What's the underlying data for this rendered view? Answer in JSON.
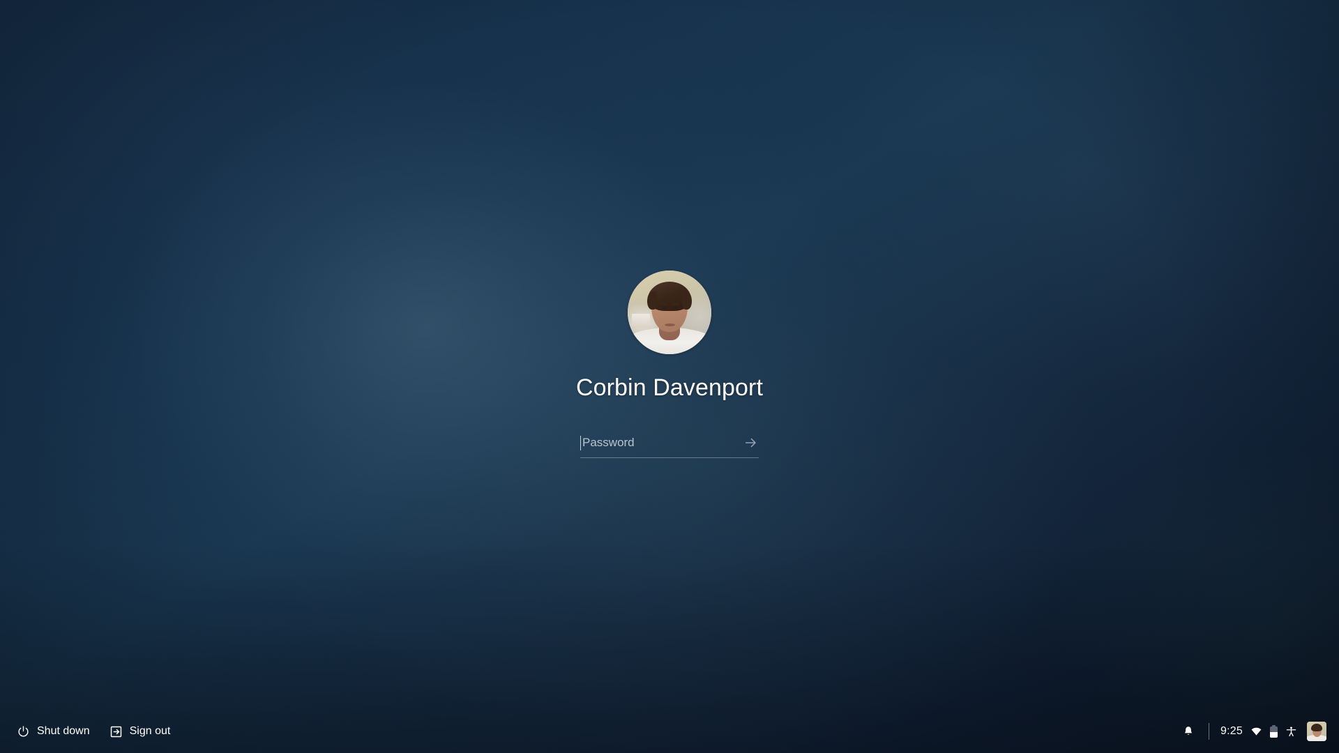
{
  "screen": {
    "kind": "lock-screen",
    "background_colors": {
      "base": "#16314b",
      "dark_edge": "#0b1624",
      "glow": "#48687e",
      "shelf": "#0d1829"
    }
  },
  "login": {
    "user_name": "Corbin Davenport",
    "avatar_icon": "user-avatar-photo",
    "password": {
      "value": "",
      "placeholder": "Password",
      "submit_icon": "arrow-right-icon",
      "caret_visible": true
    }
  },
  "shelf": {
    "left_buttons": [
      {
        "label": "Shut down",
        "icon": "power-icon"
      },
      {
        "label": "Sign out",
        "icon": "exit-to-app-icon"
      }
    ],
    "tray": {
      "notification_icon": "bell-icon",
      "time": "9:25",
      "wifi_icon": "wifi-icon",
      "battery_icon": "battery-half-icon",
      "battery_level_percent": 52,
      "accessibility_icon": "accessibility-icon",
      "avatar_icon": "user-avatar-thumbnail"
    }
  }
}
